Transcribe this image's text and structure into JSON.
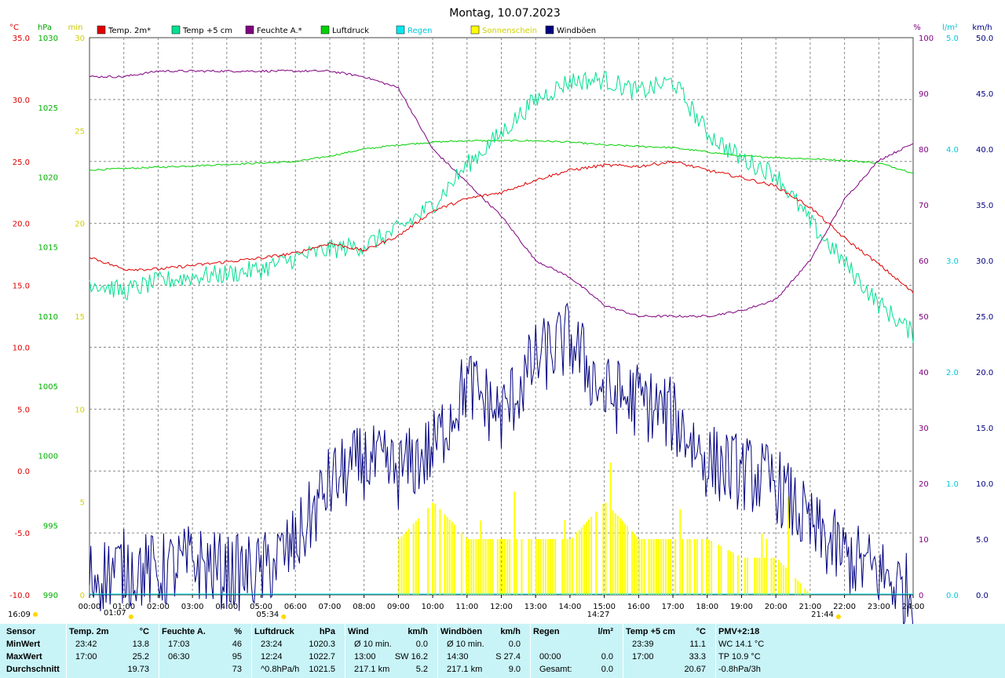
{
  "title": "Montag, 10.07.2023",
  "colors": {
    "temp2m": "#e00000",
    "temp5cm": "#00e090",
    "humidity": "#800080",
    "pressure": "#00d000",
    "rain": "#00e8f0",
    "sunshine": "#ffff00",
    "gusts": "#000080",
    "grid": "#888888"
  },
  "legend": [
    {
      "key": "temp2m",
      "label": "Temp. 2m*"
    },
    {
      "key": "temp5cm",
      "label": "Temp +5 cm"
    },
    {
      "key": "humidity",
      "label": "Feuchte A.*"
    },
    {
      "key": "pressure",
      "label": "Luftdruck"
    },
    {
      "key": "rain",
      "label": "Regen"
    },
    {
      "key": "sunshine",
      "label": "Sonnenschein"
    },
    {
      "key": "gusts",
      "label": "Windböen"
    }
  ],
  "axes": {
    "unit_temp": "°C",
    "unit_pressure": "hPa",
    "unit_sun": "min",
    "unit_humidity": "%",
    "unit_rain": "l/m²",
    "unit_wind": "km/h",
    "temp_ticks": [
      "35.0",
      "30.0",
      "25.0",
      "20.0",
      "15.0",
      "10.0",
      "5.0",
      "0.0",
      "-5.0",
      "-10.0"
    ],
    "pressure_ticks": [
      "1030",
      "1025",
      "1020",
      "1015",
      "1010",
      "1005",
      "1000",
      "995",
      "990"
    ],
    "sun_ticks": [
      "30",
      "25",
      "20",
      "15",
      "10",
      "5",
      "0"
    ],
    "humidity_ticks": [
      "100",
      "90",
      "80",
      "70",
      "60",
      "50",
      "40",
      "30",
      "20",
      "10",
      "0"
    ],
    "rain_ticks": [
      "5.0",
      "4.0",
      "3.0",
      "2.0",
      "1.0",
      "0.0"
    ],
    "wind_ticks": [
      "50.0",
      "45.0",
      "40.0",
      "35.0",
      "30.0",
      "25.0",
      "20.0",
      "15.0",
      "10.0",
      "5.0",
      "0.0"
    ],
    "x_ticks": [
      "00:00",
      "01:00",
      "02:00",
      "03:00",
      "04:00",
      "05:00",
      "06:00",
      "07:00",
      "08:00",
      "09:00",
      "10:00",
      "11:00",
      "12:00",
      "13:00",
      "14:00",
      "15:00",
      "16:00",
      "17:00",
      "18:00",
      "19:00",
      "20:00",
      "21:00",
      "22:00",
      "23:00",
      "24:00"
    ]
  },
  "markers": {
    "moonrise": "16:09",
    "moonset": "01:07",
    "sunrise": "05:34",
    "sunset": "21:44",
    "max_marker": "14:27"
  },
  "chart_data": {
    "type": "line",
    "x_unit": "hour",
    "temp2m": [
      [
        0,
        17.3
      ],
      [
        1,
        16.3
      ],
      [
        2,
        16.3
      ],
      [
        3,
        16.6
      ],
      [
        4,
        16.9
      ],
      [
        5,
        17.2
      ],
      [
        6,
        17.6
      ],
      [
        7,
        18.4
      ],
      [
        8,
        17.8
      ],
      [
        9,
        19.0
      ],
      [
        10,
        21.0
      ],
      [
        11,
        22.0
      ],
      [
        12,
        22.5
      ],
      [
        13,
        23.5
      ],
      [
        14,
        24.3
      ],
      [
        15,
        24.7
      ],
      [
        16,
        24.6
      ],
      [
        17,
        25.0
      ],
      [
        18,
        24.3
      ],
      [
        19,
        23.7
      ],
      [
        20,
        23.0
      ],
      [
        21,
        21.3
      ],
      [
        22,
        18.8
      ],
      [
        23,
        16.7
      ],
      [
        24,
        14.4
      ]
    ],
    "temp5cm": [
      [
        0,
        15.3
      ],
      [
        1,
        14.5
      ],
      [
        2,
        15.3
      ],
      [
        3,
        15.7
      ],
      [
        4,
        15.9
      ],
      [
        5,
        16.3
      ],
      [
        6,
        17.2
      ],
      [
        7,
        17.9
      ],
      [
        8,
        18.2
      ],
      [
        9,
        19.5
      ],
      [
        10,
        21.5
      ],
      [
        11,
        24.7
      ],
      [
        12,
        27.3
      ],
      [
        13,
        30.0
      ],
      [
        14,
        31.5
      ],
      [
        15,
        31.6
      ],
      [
        16,
        30.6
      ],
      [
        17,
        31.5
      ],
      [
        18,
        27.3
      ],
      [
        19,
        25.2
      ],
      [
        20,
        24.0
      ],
      [
        21,
        20.1
      ],
      [
        22,
        16.8
      ],
      [
        23,
        13.5
      ],
      [
        24,
        11.1
      ]
    ],
    "humidity": [
      [
        0,
        93
      ],
      [
        1,
        93
      ],
      [
        2,
        94
      ],
      [
        3,
        94
      ],
      [
        4,
        94
      ],
      [
        5,
        94
      ],
      [
        6,
        94
      ],
      [
        7,
        94
      ],
      [
        8,
        93
      ],
      [
        9,
        91
      ],
      [
        10,
        80
      ],
      [
        11,
        74
      ],
      [
        12,
        68
      ],
      [
        13,
        60
      ],
      [
        14,
        57
      ],
      [
        15,
        52
      ],
      [
        16,
        50
      ],
      [
        17,
        50
      ],
      [
        18,
        50
      ],
      [
        19,
        51
      ],
      [
        20,
        53
      ],
      [
        21,
        60
      ],
      [
        22,
        71
      ],
      [
        23,
        78
      ],
      [
        24,
        81
      ]
    ],
    "pressure": [
      [
        0,
        1020.5
      ],
      [
        1,
        1020.6
      ],
      [
        2,
        1020.7
      ],
      [
        3,
        1020.8
      ],
      [
        4,
        1020.9
      ],
      [
        5,
        1021.0
      ],
      [
        6,
        1021.1
      ],
      [
        7,
        1021.5
      ],
      [
        8,
        1022.0
      ],
      [
        9,
        1022.3
      ],
      [
        10,
        1022.5
      ],
      [
        11,
        1022.6
      ],
      [
        12,
        1022.6
      ],
      [
        13,
        1022.6
      ],
      [
        14,
        1022.5
      ],
      [
        15,
        1022.3
      ],
      [
        16,
        1022.2
      ],
      [
        17,
        1022.1
      ],
      [
        18,
        1021.8
      ],
      [
        19,
        1021.5
      ],
      [
        20,
        1021.4
      ],
      [
        21,
        1021.3
      ],
      [
        22,
        1021.2
      ],
      [
        23,
        1021.0
      ],
      [
        24,
        1020.3
      ]
    ],
    "gusts": [
      [
        0,
        1.5
      ],
      [
        1,
        2.5
      ],
      [
        2,
        2.0
      ],
      [
        3,
        3.0
      ],
      [
        4,
        2.0
      ],
      [
        5,
        2.0
      ],
      [
        6,
        4.5
      ],
      [
        7,
        10.0
      ],
      [
        8,
        12.0
      ],
      [
        9,
        11.0
      ],
      [
        10,
        13.0
      ],
      [
        11,
        19.0
      ],
      [
        12,
        16.0
      ],
      [
        13,
        21.0
      ],
      [
        14,
        23.0
      ],
      [
        15,
        18.0
      ],
      [
        16,
        17.5
      ],
      [
        17,
        16.0
      ],
      [
        18,
        12.0
      ],
      [
        19,
        11.0
      ],
      [
        20,
        10.0
      ],
      [
        21,
        6.0
      ],
      [
        22,
        3.5
      ],
      [
        23,
        2.0
      ],
      [
        24,
        0.0
      ]
    ],
    "sunshine": [
      [
        0,
        0
      ],
      [
        5,
        0
      ],
      [
        9,
        3
      ],
      [
        10,
        5
      ],
      [
        11,
        3
      ],
      [
        12,
        3
      ],
      [
        13,
        3
      ],
      [
        14,
        3
      ],
      [
        15,
        5
      ],
      [
        16,
        3
      ],
      [
        17,
        3
      ],
      [
        18,
        3
      ],
      [
        19,
        2
      ],
      [
        20,
        2
      ],
      [
        21,
        0
      ],
      [
        24,
        0
      ]
    ],
    "rain": [
      [
        0,
        0
      ],
      [
        24,
        0
      ]
    ]
  },
  "table": {
    "headers": [
      {
        "label": "Sensor",
        "unit": ""
      },
      {
        "label": "Temp. 2m",
        "unit": "°C"
      },
      {
        "label": "Feuchte A.",
        "unit": "%"
      },
      {
        "label": "Luftdruck",
        "unit": "hPa"
      },
      {
        "label": "Wind",
        "unit": "km/h"
      },
      {
        "label": "Windböen",
        "unit": "km/h"
      },
      {
        "label": "Regen",
        "unit": "l/m²"
      },
      {
        "label": "Temp +5 cm",
        "unit": "°C"
      },
      {
        "label": "PMV+2:18",
        "unit": ""
      }
    ],
    "rows": [
      {
        "label": "MinWert",
        "cells": [
          [
            "23:42",
            "13.8"
          ],
          [
            "17:03",
            "46"
          ],
          [
            "23:24",
            "1020.3"
          ],
          [
            "Ø 10 min.",
            "0.0"
          ],
          [
            "Ø 10 min.",
            "0.0"
          ],
          [
            "",
            ""
          ],
          [
            "23:39",
            "11.1"
          ],
          [
            "WC 14.1 °C",
            ""
          ]
        ]
      },
      {
        "label": "MaxWert",
        "cells": [
          [
            "17:00",
            "25.2"
          ],
          [
            "06:30",
            "95"
          ],
          [
            "12:24",
            "1022.7"
          ],
          [
            "13:00",
            "SW 16.2"
          ],
          [
            "14:30",
            "S 27.4"
          ],
          [
            "00:00",
            "0.0"
          ],
          [
            "17:00",
            "33.3"
          ],
          [
            "TP 10.9 °C",
            ""
          ]
        ]
      },
      {
        "label": "Durchschnitt",
        "cells": [
          [
            "",
            "19.73"
          ],
          [
            "",
            "73"
          ],
          [
            "^0.8hPa/h",
            "1021.5"
          ],
          [
            "217.1 km",
            "5.2"
          ],
          [
            "217.1 km",
            "9.0"
          ],
          [
            "Gesamt:",
            "0.0"
          ],
          [
            "",
            "20.67"
          ],
          [
            "-0.8hPa/3h",
            ""
          ]
        ]
      }
    ]
  }
}
